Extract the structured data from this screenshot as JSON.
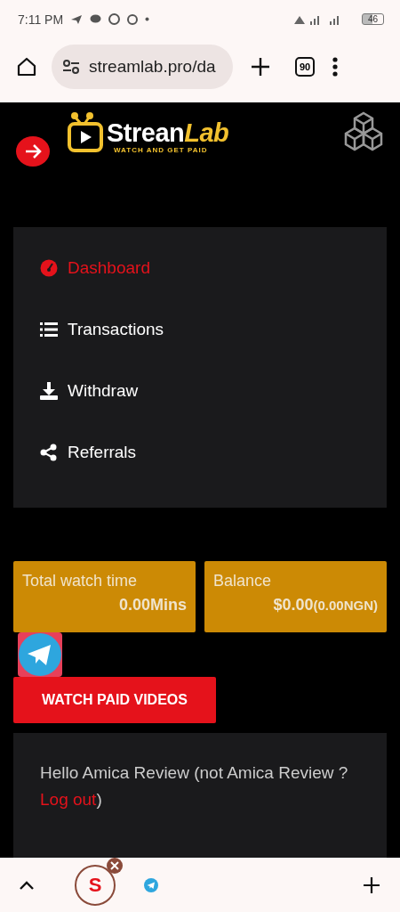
{
  "status_bar": {
    "time": "7:11 PM",
    "battery": "46"
  },
  "browser": {
    "url": "streamlab.pro/da",
    "tab_count": "90"
  },
  "logo": {
    "part1": "Strean",
    "part2": "Lab",
    "tagline": "WATCH AND GET PAID"
  },
  "menu": [
    {
      "label": "Dashboard",
      "kind": "dashboard",
      "selected": true
    },
    {
      "label": "Transactions",
      "kind": "list",
      "selected": false
    },
    {
      "label": "Withdraw",
      "kind": "download",
      "selected": false
    },
    {
      "label": "Referrals",
      "kind": "share",
      "selected": false
    }
  ],
  "stats": [
    {
      "label": "Total watch time",
      "value": "0.00Mins"
    },
    {
      "label": "Balance",
      "value": "$0.00",
      "extra": "(0.00NGN)"
    }
  ],
  "watch_button": "WATCH PAID VIDEOS",
  "greeting": {
    "text": "Hello Amica Review (not Amica Review ? ",
    "link": "Log out",
    "after": ")"
  },
  "bottom_bar": {
    "bubble_letter": "S"
  }
}
